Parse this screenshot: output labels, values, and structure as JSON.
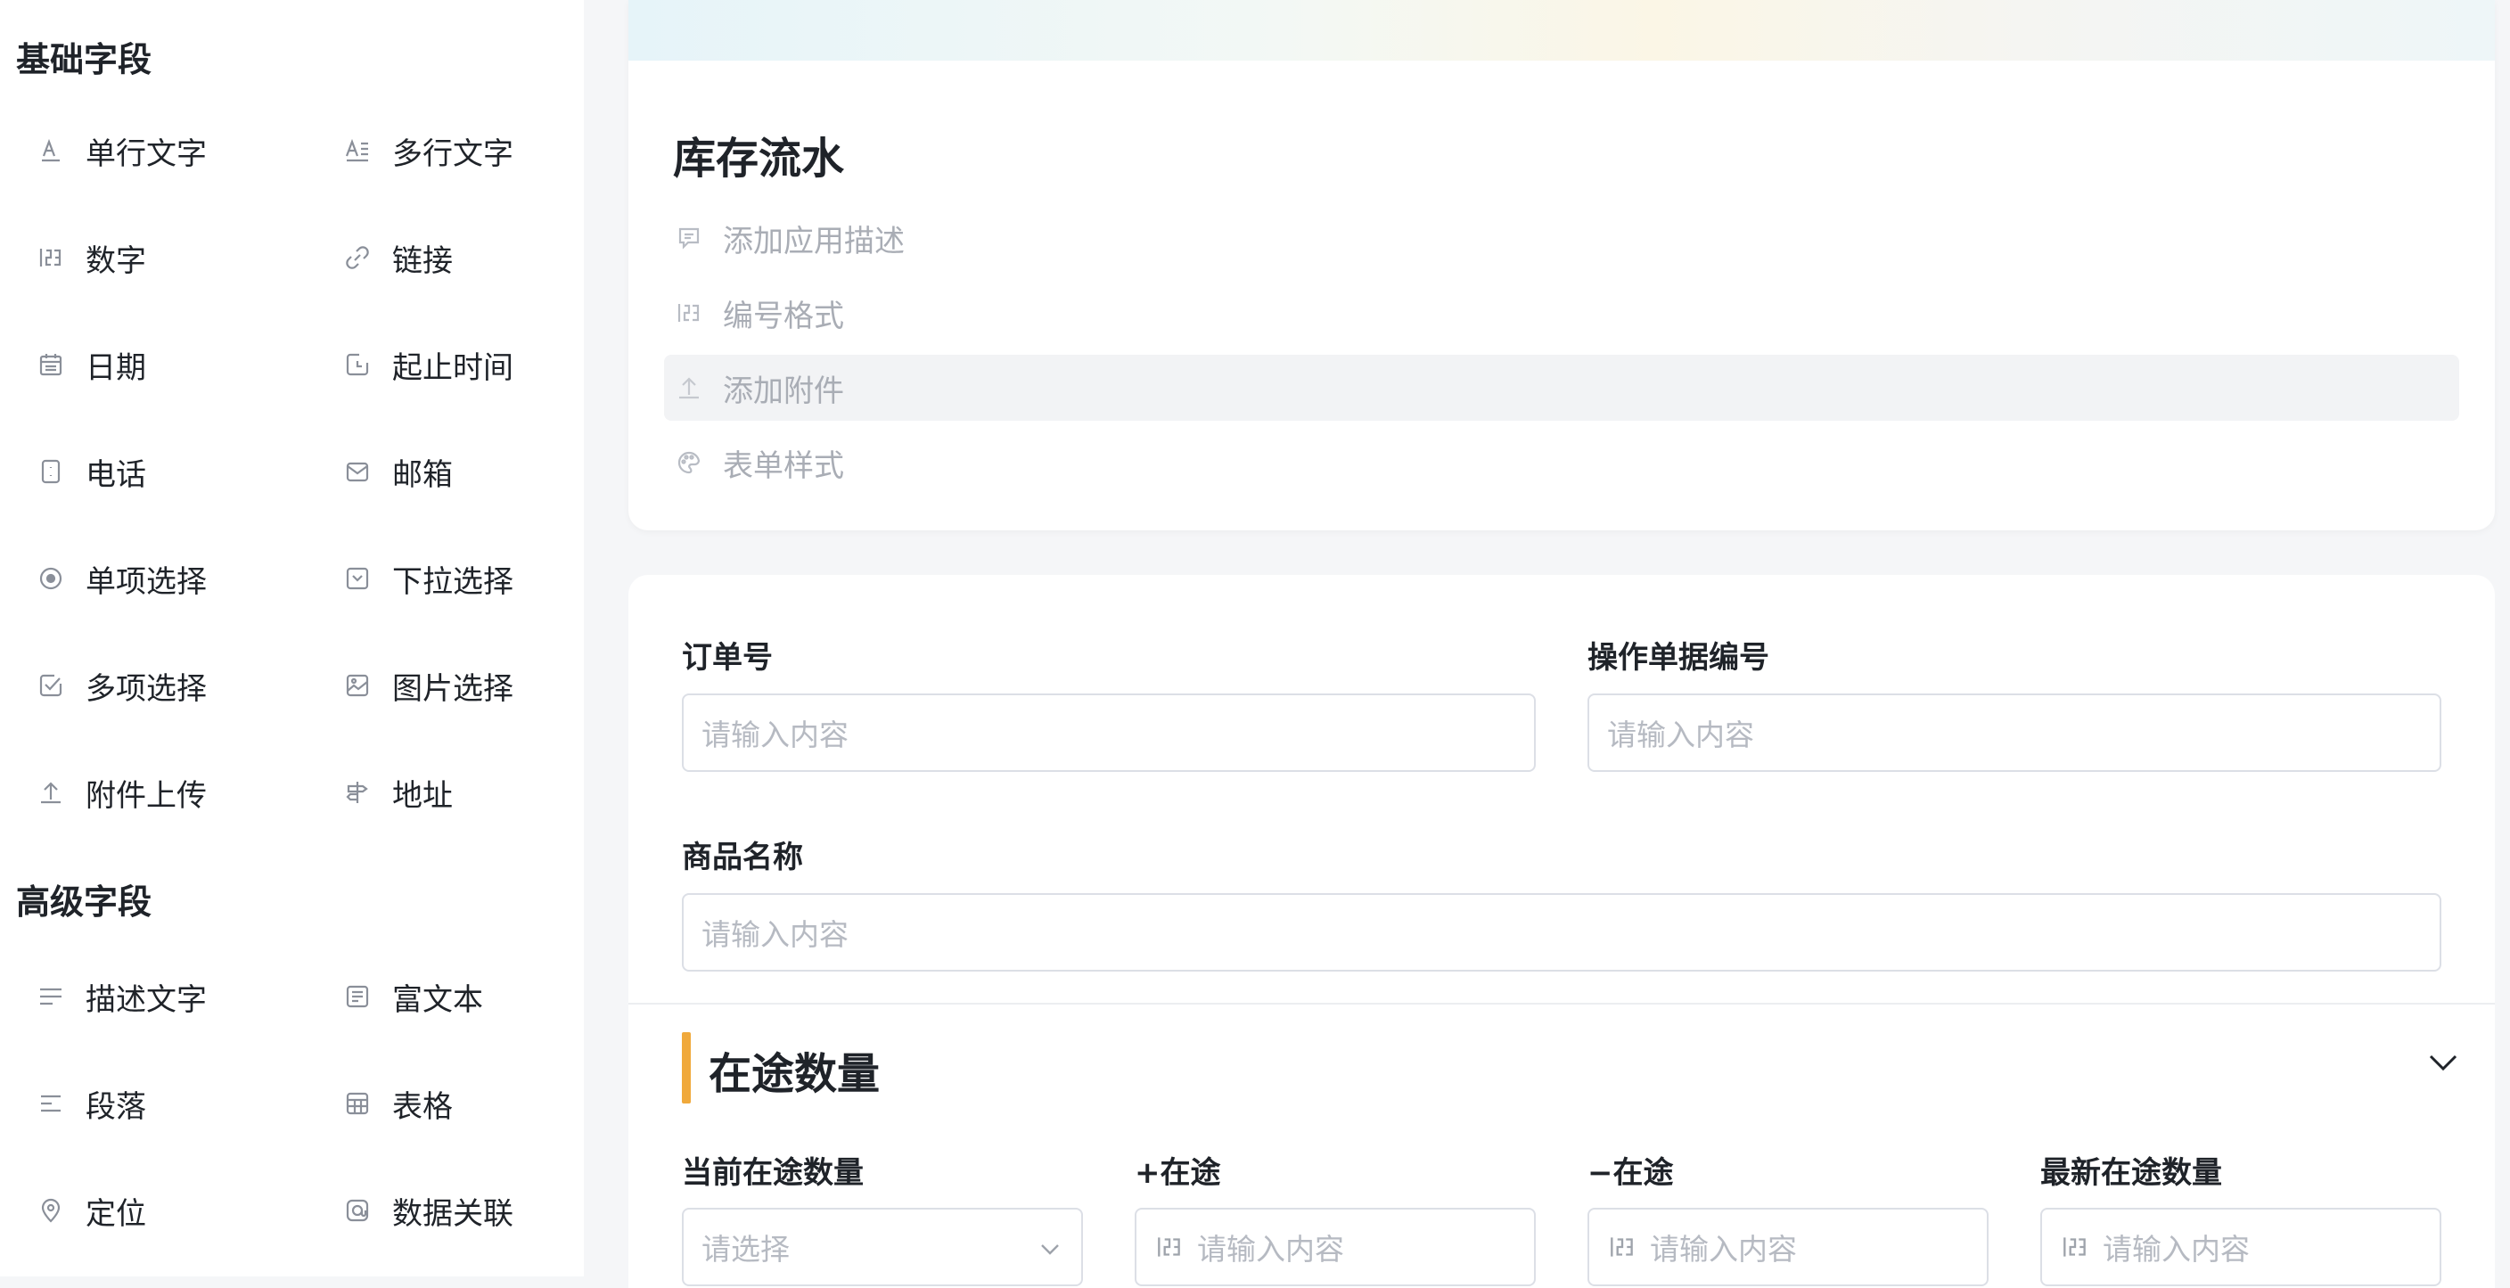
{
  "sidebar": {
    "basic_title": "基础字段",
    "advanced_title": "高级字段",
    "basic_items": [
      {
        "label": "单行文字",
        "icon": "single-line-text-icon"
      },
      {
        "label": "多行文字",
        "icon": "multi-line-text-icon"
      },
      {
        "label": "数字",
        "icon": "number-icon"
      },
      {
        "label": "链接",
        "icon": "link-icon"
      },
      {
        "label": "日期",
        "icon": "calendar-icon"
      },
      {
        "label": "起止时间",
        "icon": "time-range-icon"
      },
      {
        "label": "电话",
        "icon": "phone-icon"
      },
      {
        "label": "邮箱",
        "icon": "mail-icon"
      },
      {
        "label": "单项选择",
        "icon": "radio-icon"
      },
      {
        "label": "下拉选择",
        "icon": "dropdown-icon"
      },
      {
        "label": "多项选择",
        "icon": "checkbox-icon"
      },
      {
        "label": "图片选择",
        "icon": "image-icon"
      },
      {
        "label": "附件上传",
        "icon": "upload-icon"
      },
      {
        "label": "地址",
        "icon": "signpost-icon"
      }
    ],
    "advanced_items": [
      {
        "label": "描述文字",
        "icon": "description-icon"
      },
      {
        "label": "富文本",
        "icon": "rich-text-icon"
      },
      {
        "label": "段落",
        "icon": "paragraph-icon"
      },
      {
        "label": "表格",
        "icon": "table-icon"
      },
      {
        "label": "定位",
        "icon": "location-icon"
      },
      {
        "label": "数据关联",
        "icon": "data-link-icon"
      }
    ]
  },
  "app": {
    "title": "库存流水",
    "options": [
      {
        "label": "添加应用描述",
        "icon": "comment-icon"
      },
      {
        "label": "编号格式",
        "icon": "number-format-icon"
      },
      {
        "label": "添加附件",
        "icon": "upload-icon"
      },
      {
        "label": "表单样式",
        "icon": "palette-icon"
      }
    ]
  },
  "form": {
    "fields": [
      {
        "label": "订单号",
        "placeholder": "请输入内容"
      },
      {
        "label": "操作单据编号",
        "placeholder": "请输入内容"
      },
      {
        "label": "商品名称",
        "placeholder": "请输入内容"
      }
    ],
    "section": {
      "title": "在途数量",
      "fields": [
        {
          "label": "当前在途数量",
          "placeholder": "请选择"
        },
        {
          "label": "+在途",
          "placeholder": "请输入内容"
        },
        {
          "label": "−在途",
          "placeholder": "请输入内容"
        },
        {
          "label": "最新在途数量",
          "placeholder": "请输入内容"
        }
      ]
    }
  },
  "colors": {
    "accent_bar": "#f0a93b",
    "hover_row": "#f2f3f5",
    "placeholder_text": "#b6bac2"
  }
}
